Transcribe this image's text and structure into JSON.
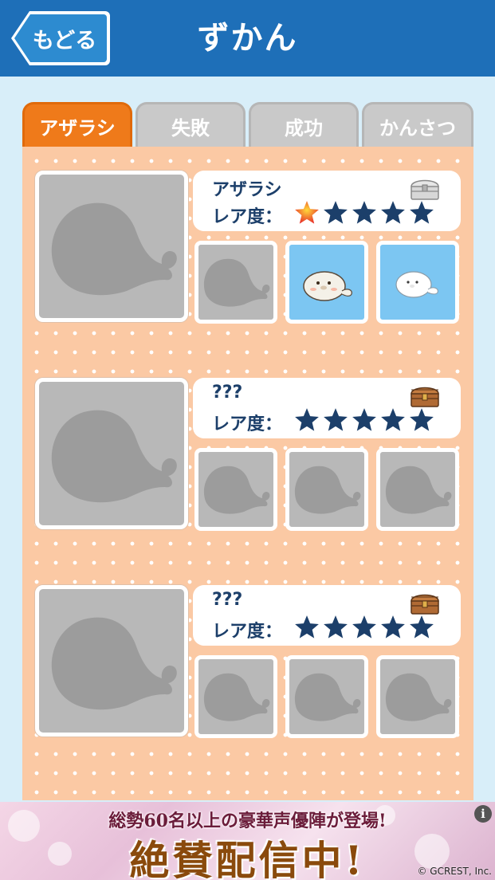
{
  "header": {
    "back_label": "もどる",
    "title": "ずかん"
  },
  "tabs": [
    {
      "label": "アザラシ",
      "active": true
    },
    {
      "label": "失敗",
      "active": false
    },
    {
      "label": "成功",
      "active": false
    },
    {
      "label": "かんさつ",
      "active": false
    }
  ],
  "entries": [
    {
      "name": "アザラシ",
      "rarity_label": "レア度：",
      "rarity_stars": 1,
      "chest": "chest-silver-icon",
      "variants": [
        "locked",
        "unlocked",
        "unlocked"
      ]
    },
    {
      "name": "???",
      "rarity_label": "レア度：",
      "rarity_stars": 0,
      "chest": "chest-brown-icon",
      "variants": [
        "locked",
        "locked",
        "locked"
      ]
    },
    {
      "name": "???",
      "rarity_label": "レア度：",
      "rarity_stars": 0,
      "chest": "chest-brown-icon",
      "variants": [
        "locked",
        "locked",
        "locked"
      ]
    }
  ],
  "ad": {
    "line1": "総勢60名以上の豪華声優陣が登場!",
    "line2": "絶賛配信中!",
    "info": "i",
    "copyright": "© GCREST, Inc."
  },
  "colors": {
    "header": "#1e6fb8",
    "tab_active": "#ef7a1a",
    "tab_inactive": "#c9c9c9",
    "panel": "#fbc9a4",
    "star": "#1c3f6a",
    "star_earned": "#e8322a"
  }
}
